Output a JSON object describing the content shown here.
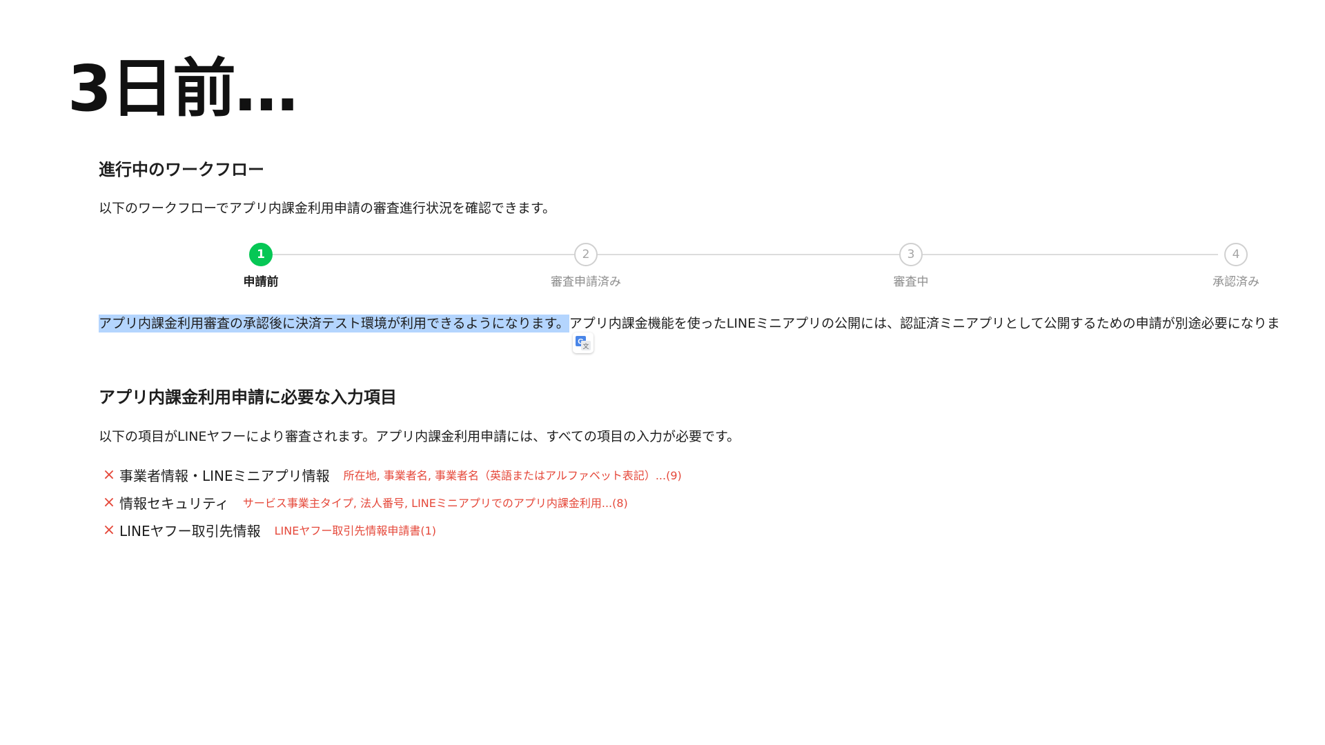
{
  "slide": {
    "title": "3日前…"
  },
  "workflow": {
    "title": "進行中のワークフロー",
    "description": "以下のワークフローでアプリ内課金利用申請の審査進行状況を確認できます。",
    "steps": [
      {
        "number": "1",
        "label": "申請前",
        "state": "current"
      },
      {
        "number": "2",
        "label": "審査申請済み",
        "state": "pending"
      },
      {
        "number": "3",
        "label": "審査中",
        "state": "pending"
      },
      {
        "number": "4",
        "label": "承認済み",
        "state": "pending"
      }
    ],
    "notice_highlighted": "アプリ内課金利用審査の承認後に決済テスト環境が利用できるようになります。",
    "notice_rest": "アプリ内課金機能を使ったLINEミニアプリの公開には、認証済ミニアプリとして公開するための申請が別途必要になりま"
  },
  "requirements": {
    "title": "アプリ内課金利用申請に必要な入力項目",
    "description": "以下の項目がLINEヤフーにより審査されます。アプリ内課金利用申請には、すべての項目の入力が必要です。",
    "status_icon": "×",
    "status_color": "#e5483a",
    "items": [
      {
        "label": "事業者情報・LINEミニアプリ情報",
        "detail": "所在地, 事業者名, 事業者名（英語またはアルファベット表記）...(9)"
      },
      {
        "label": "情報セキュリティ",
        "detail": "サービス事業主タイプ, 法人番号, LINEミニアプリでのアプリ内課金利用...(8)"
      },
      {
        "label": "LINEヤフー取引先情報",
        "detail": "LINEヤフー取引先情報申請書(1)"
      }
    ]
  },
  "colors": {
    "accent_green": "#06c755",
    "error_red": "#e5483a",
    "selection_blue": "#b4d5fe"
  },
  "icons": {
    "translate": "google-translate-icon",
    "step_status": "x-mark-icon"
  }
}
